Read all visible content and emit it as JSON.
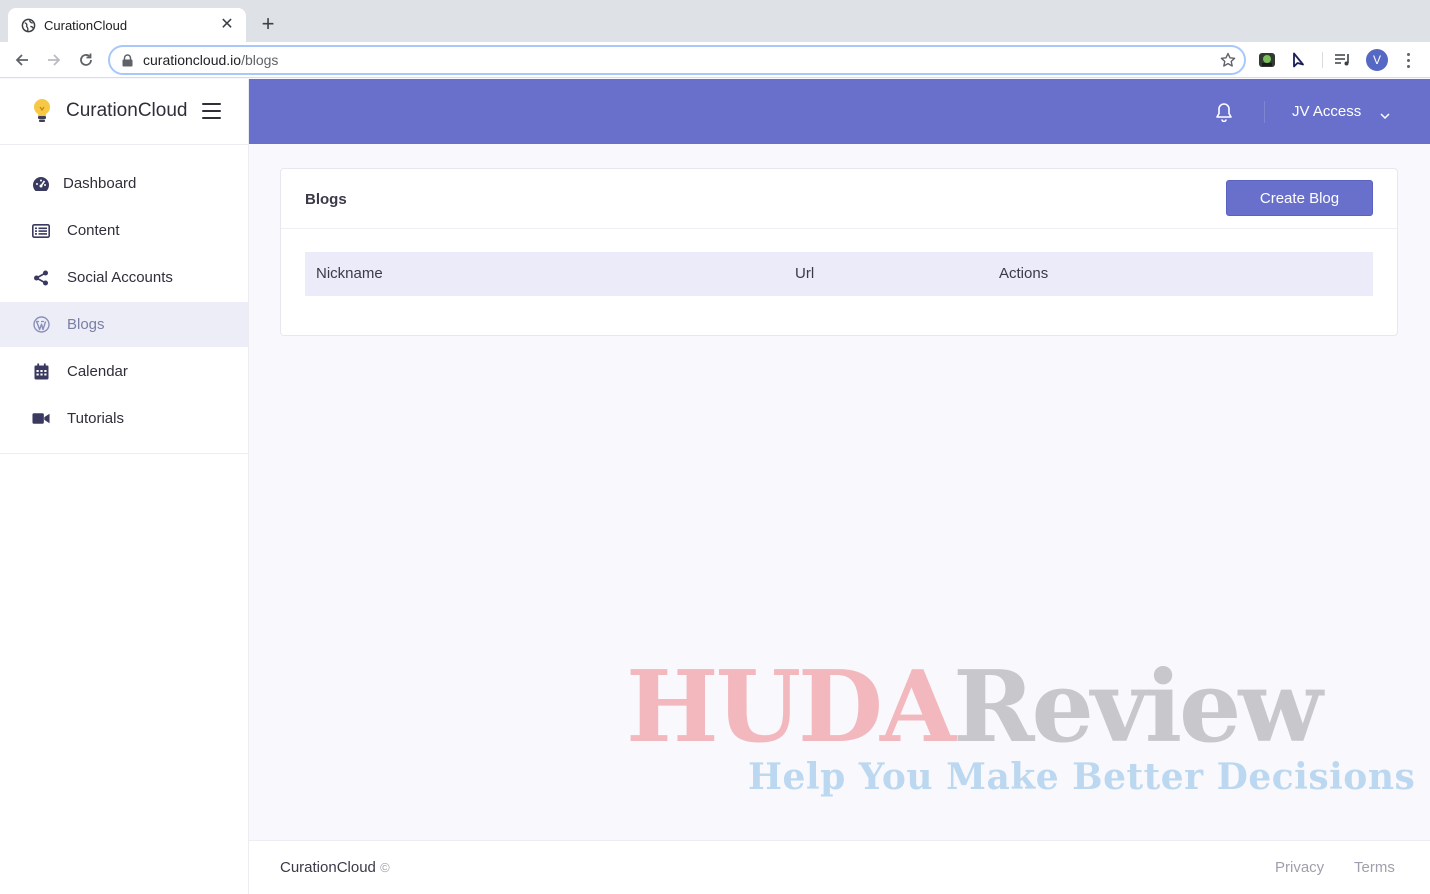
{
  "browser": {
    "tab_title": "CurationCloud",
    "tab_close": "✕",
    "new_tab": "+",
    "url_domain": "curationcloud.io",
    "url_path": "/blogs",
    "profile_initial": "V"
  },
  "app": {
    "brand": "CurationCloud",
    "accent_color": "#6870cc",
    "user_menu_label": "JV Access"
  },
  "sidebar": {
    "items": [
      {
        "label": "Dashboard",
        "icon": "dashboard-gauge-icon"
      },
      {
        "label": "Content",
        "icon": "list-icon"
      },
      {
        "label": "Social Accounts",
        "icon": "share-icon"
      },
      {
        "label": "Blogs",
        "icon": "wordpress-icon",
        "active": true
      },
      {
        "label": "Calendar",
        "icon": "calendar-icon"
      },
      {
        "label": "Tutorials",
        "icon": "video-camera-icon"
      }
    ]
  },
  "main": {
    "card_title": "Blogs",
    "create_button": "Create Blog",
    "table_headers": [
      "Nickname",
      "Url",
      "Actions"
    ]
  },
  "watermark": {
    "title_part1": "HUDA",
    "title_part2": "Review",
    "tagline": "Help You Make Better Decisions"
  },
  "footer": {
    "brand": "CurationCloud",
    "copyright": "©",
    "links": [
      "Privacy",
      "Terms"
    ]
  }
}
